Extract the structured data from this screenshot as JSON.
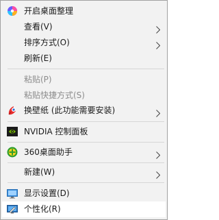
{
  "menu": {
    "items": [
      {
        "label": "开启桌面整理",
        "icon": "desktop-organizer-icon"
      },
      {
        "label": "查看(V)",
        "submenu": true
      },
      {
        "label": "排序方式(O)",
        "submenu": true
      },
      {
        "label": "刷新(E)"
      },
      {
        "label": "粘贴(P)",
        "disabled": true
      },
      {
        "label": "粘贴快捷方式(S)",
        "disabled": true
      },
      {
        "label": "换壁纸 (此功能需要安装)",
        "icon": "wallpaper-icon",
        "submenu": true
      },
      {
        "label": "NVIDIA 控制面板",
        "icon": "nvidia-icon"
      },
      {
        "label": "360桌面助手",
        "icon": "360-desktop-icon",
        "submenu": true
      },
      {
        "label": "新建(W)",
        "submenu": true
      },
      {
        "label": "显示设置(D)",
        "icon": "display-settings-icon"
      },
      {
        "label": "个性化(R)",
        "icon": "personalize-icon",
        "highlighted": true
      }
    ]
  },
  "colors": {
    "menu_background": "#f2f2f2",
    "hover_background": "#ffffff",
    "disabled_text": "#8c8c8c",
    "separator": "#d6d6d6"
  }
}
